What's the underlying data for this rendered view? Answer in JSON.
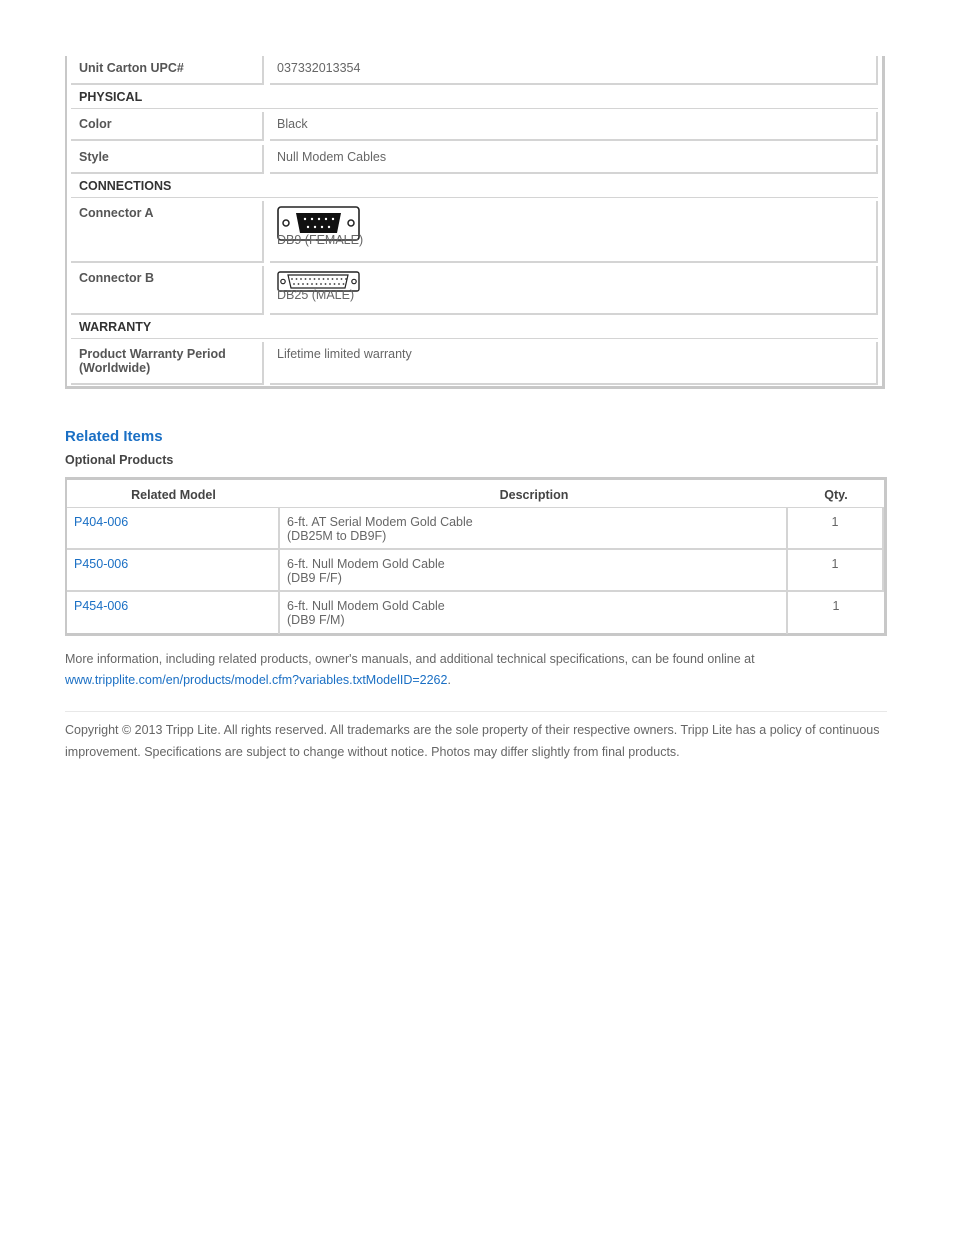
{
  "specs": {
    "unit_carton_upc": {
      "label": "Unit Carton UPC#",
      "value": "037332013354"
    },
    "physical_heading": "PHYSICAL",
    "color": {
      "label": "Color",
      "value": "Black"
    },
    "style": {
      "label": "Style",
      "value": "Null Modem Cables"
    },
    "connections_heading": "CONNECTIONS",
    "connector_a": {
      "label": "Connector A",
      "caption": "DB9 (FEMALE)",
      "icon": "db9-female-connector-icon"
    },
    "connector_b": {
      "label": "Connector B",
      "caption": "DB25 (MALE)",
      "icon": "db25-male-connector-icon"
    },
    "warranty_heading": "WARRANTY",
    "warranty": {
      "label": "Product Warranty Period (Worldwide)",
      "value": "Lifetime limited warranty"
    }
  },
  "related": {
    "title": "Related Items",
    "subtitle": "Optional Products",
    "headers": {
      "model": "Related Model",
      "description": "Description",
      "qty": "Qty."
    },
    "rows": [
      {
        "model": "P404-006",
        "desc_line1": "6-ft. AT Serial Modem Gold Cable",
        "desc_line2": "(DB25M to DB9F)",
        "qty": "1"
      },
      {
        "model": "P450-006",
        "desc_line1": "6-ft. Null Modem Gold Cable",
        "desc_line2": "(DB9 F/F)",
        "qty": "1"
      },
      {
        "model": "P454-006",
        "desc_line1": "6-ft. Null Modem Gold Cable",
        "desc_line2": "(DB9 F/M)",
        "qty": "1"
      }
    ]
  },
  "footer": {
    "info_text": "More information, including related products, owner's manuals, and additional technical specifications, can be found online at",
    "info_link": "www.tripplite.com/en/products/model.cfm?variables.txtModelID=2262",
    "info_suffix": ".",
    "copyright": "Copyright © 2013 Tripp Lite. All rights reserved. All trademarks are the sole property of their respective owners. Tripp Lite has a policy of continuous improvement. Specifications are subject to change without notice. Photos may differ slightly from final products."
  },
  "colors": {
    "link": "#1a6fc4",
    "border": "#c8c8c8",
    "text": "#555555"
  }
}
